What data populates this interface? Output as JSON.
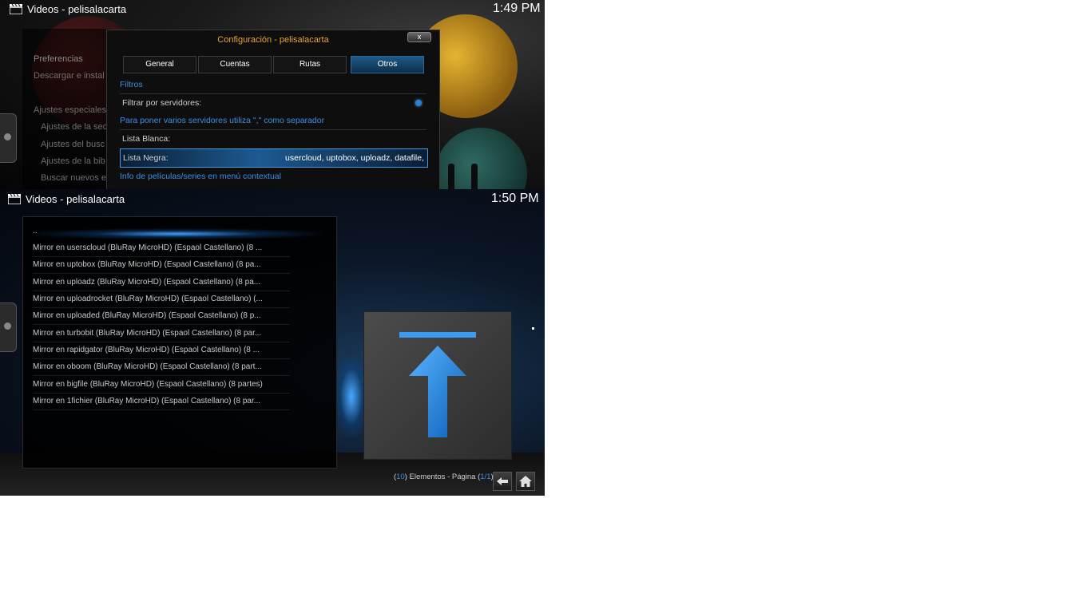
{
  "top": {
    "header": {
      "title": "Videos  - pelisalacarta",
      "icon": "clapperboard-icon"
    },
    "clock": "1:49 PM",
    "side_menu": {
      "items": [
        "Preferencias",
        "Descargar e instal",
        "Ajustes especiales",
        "Ajustes de la sec",
        "Ajustes del busc",
        "Ajustes de la bib",
        "Buscar nuevos e"
      ]
    },
    "dialog": {
      "title": "Configuración - pelisalacarta",
      "close_label": "x",
      "tabs": [
        {
          "label": "General",
          "active": false
        },
        {
          "label": "Cuentas",
          "active": false
        },
        {
          "label": "Rutas",
          "active": false
        },
        {
          "label": "Otros",
          "active": true
        }
      ],
      "section_filtros": "Filtros",
      "filter_servers_label": "Filtrar por servidores:",
      "hint": "Para poner varios servidores utiliza \",\" como separador",
      "whitelist_label": "Lista Blanca:",
      "blacklist_label": "Lista Negra:",
      "blacklist_value": "usercloud, uptobox, uploadz, datafile,",
      "section_info": "Info de películas/series en menú contextual"
    }
  },
  "bottom": {
    "header": {
      "title": "Videos  - pelisalacarta",
      "icon": "clapperboard-icon"
    },
    "clock": "1:50 PM",
    "list": {
      "parent": "..",
      "items": [
        "Mirror en userscloud (BluRay MicroHD) (Espaol Castellano) (8 ...",
        "Mirror en uptobox (BluRay MicroHD) (Espaol Castellano) (8 pa...",
        "Mirror en uploadz (BluRay MicroHD) (Espaol Castellano) (8 pa...",
        "Mirror en uploadrocket (BluRay MicroHD) (Espaol Castellano) (...",
        "Mirror en uploaded (BluRay MicroHD) (Espaol Castellano) (8 p...",
        "Mirror en turbobit (BluRay MicroHD) (Espaol Castellano) (8 par...",
        "Mirror en rapidgator (BluRay MicroHD) (Espaol Castellano) (8 ...",
        "Mirror en oboom (BluRay MicroHD) (Espaol Castellano) (8 part...",
        "Mirror en bigfile (BluRay MicroHD) (Espaol Castellano) (8 partes)",
        "Mirror en 1fichier (BluRay MicroHD) (Espaol Castellano) (8 par..."
      ]
    },
    "thumbnail_icon": "up-arrow-icon",
    "footer": {
      "paren_open": "(",
      "count": "10",
      "elements_text": ") Elementos - Página (",
      "page": "1/1",
      "paren_close": ")",
      "back_icon": "back-arrow-icon",
      "home_icon": "home-icon"
    },
    "accent_color": "#3d8fe3"
  }
}
